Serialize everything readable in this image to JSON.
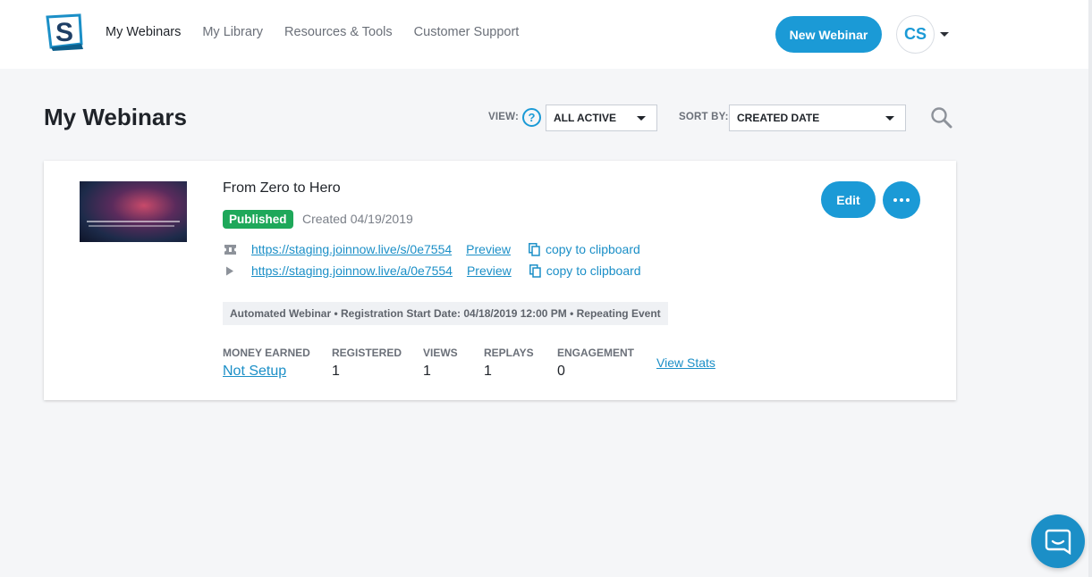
{
  "header": {
    "logo_letter": "S",
    "nav": [
      {
        "label": "My Webinars",
        "active": true
      },
      {
        "label": "My Library",
        "active": false
      },
      {
        "label": "Resources & Tools",
        "active": false
      },
      {
        "label": "Customer Support",
        "active": false
      }
    ],
    "new_webinar_label": "New Webinar",
    "avatar_initials": "CS"
  },
  "page": {
    "title": "My Webinars",
    "view_label": "VIEW:",
    "help_glyph": "?",
    "view_value": "ALL ACTIVE",
    "sort_label": "SORT BY:",
    "sort_value": "CREATED DATE"
  },
  "webinar": {
    "title": "From Zero to Hero",
    "status": "Published",
    "created": "Created 04/19/2019",
    "links": [
      {
        "icon": "ticket-icon",
        "url": "https://staging.joinnow.live/s/0e7554",
        "preview": "Preview",
        "copy": "copy to clipboard"
      },
      {
        "icon": "play-icon",
        "url": "https://staging.joinnow.live/a/0e7554",
        "preview": "Preview",
        "copy": "copy to clipboard"
      }
    ],
    "meta": "Automated Webinar • Registration Start Date: 04/18/2019 12:00 PM • Repeating Event",
    "stats": {
      "money_label": "MONEY EARNED",
      "money_value": "Not Setup",
      "registered_label": "REGISTERED",
      "registered_value": "1",
      "views_label": "VIEWS",
      "views_value": "1",
      "replays_label": "REPLAYS",
      "replays_value": "1",
      "engagement_label": "ENGAGEMENT",
      "engagement_value": "0"
    },
    "view_stats_label": "View Stats",
    "edit_label": "Edit"
  },
  "colors": {
    "accent": "#1b9ad6",
    "published": "#1ea85a",
    "background": "#f5f6f8"
  }
}
